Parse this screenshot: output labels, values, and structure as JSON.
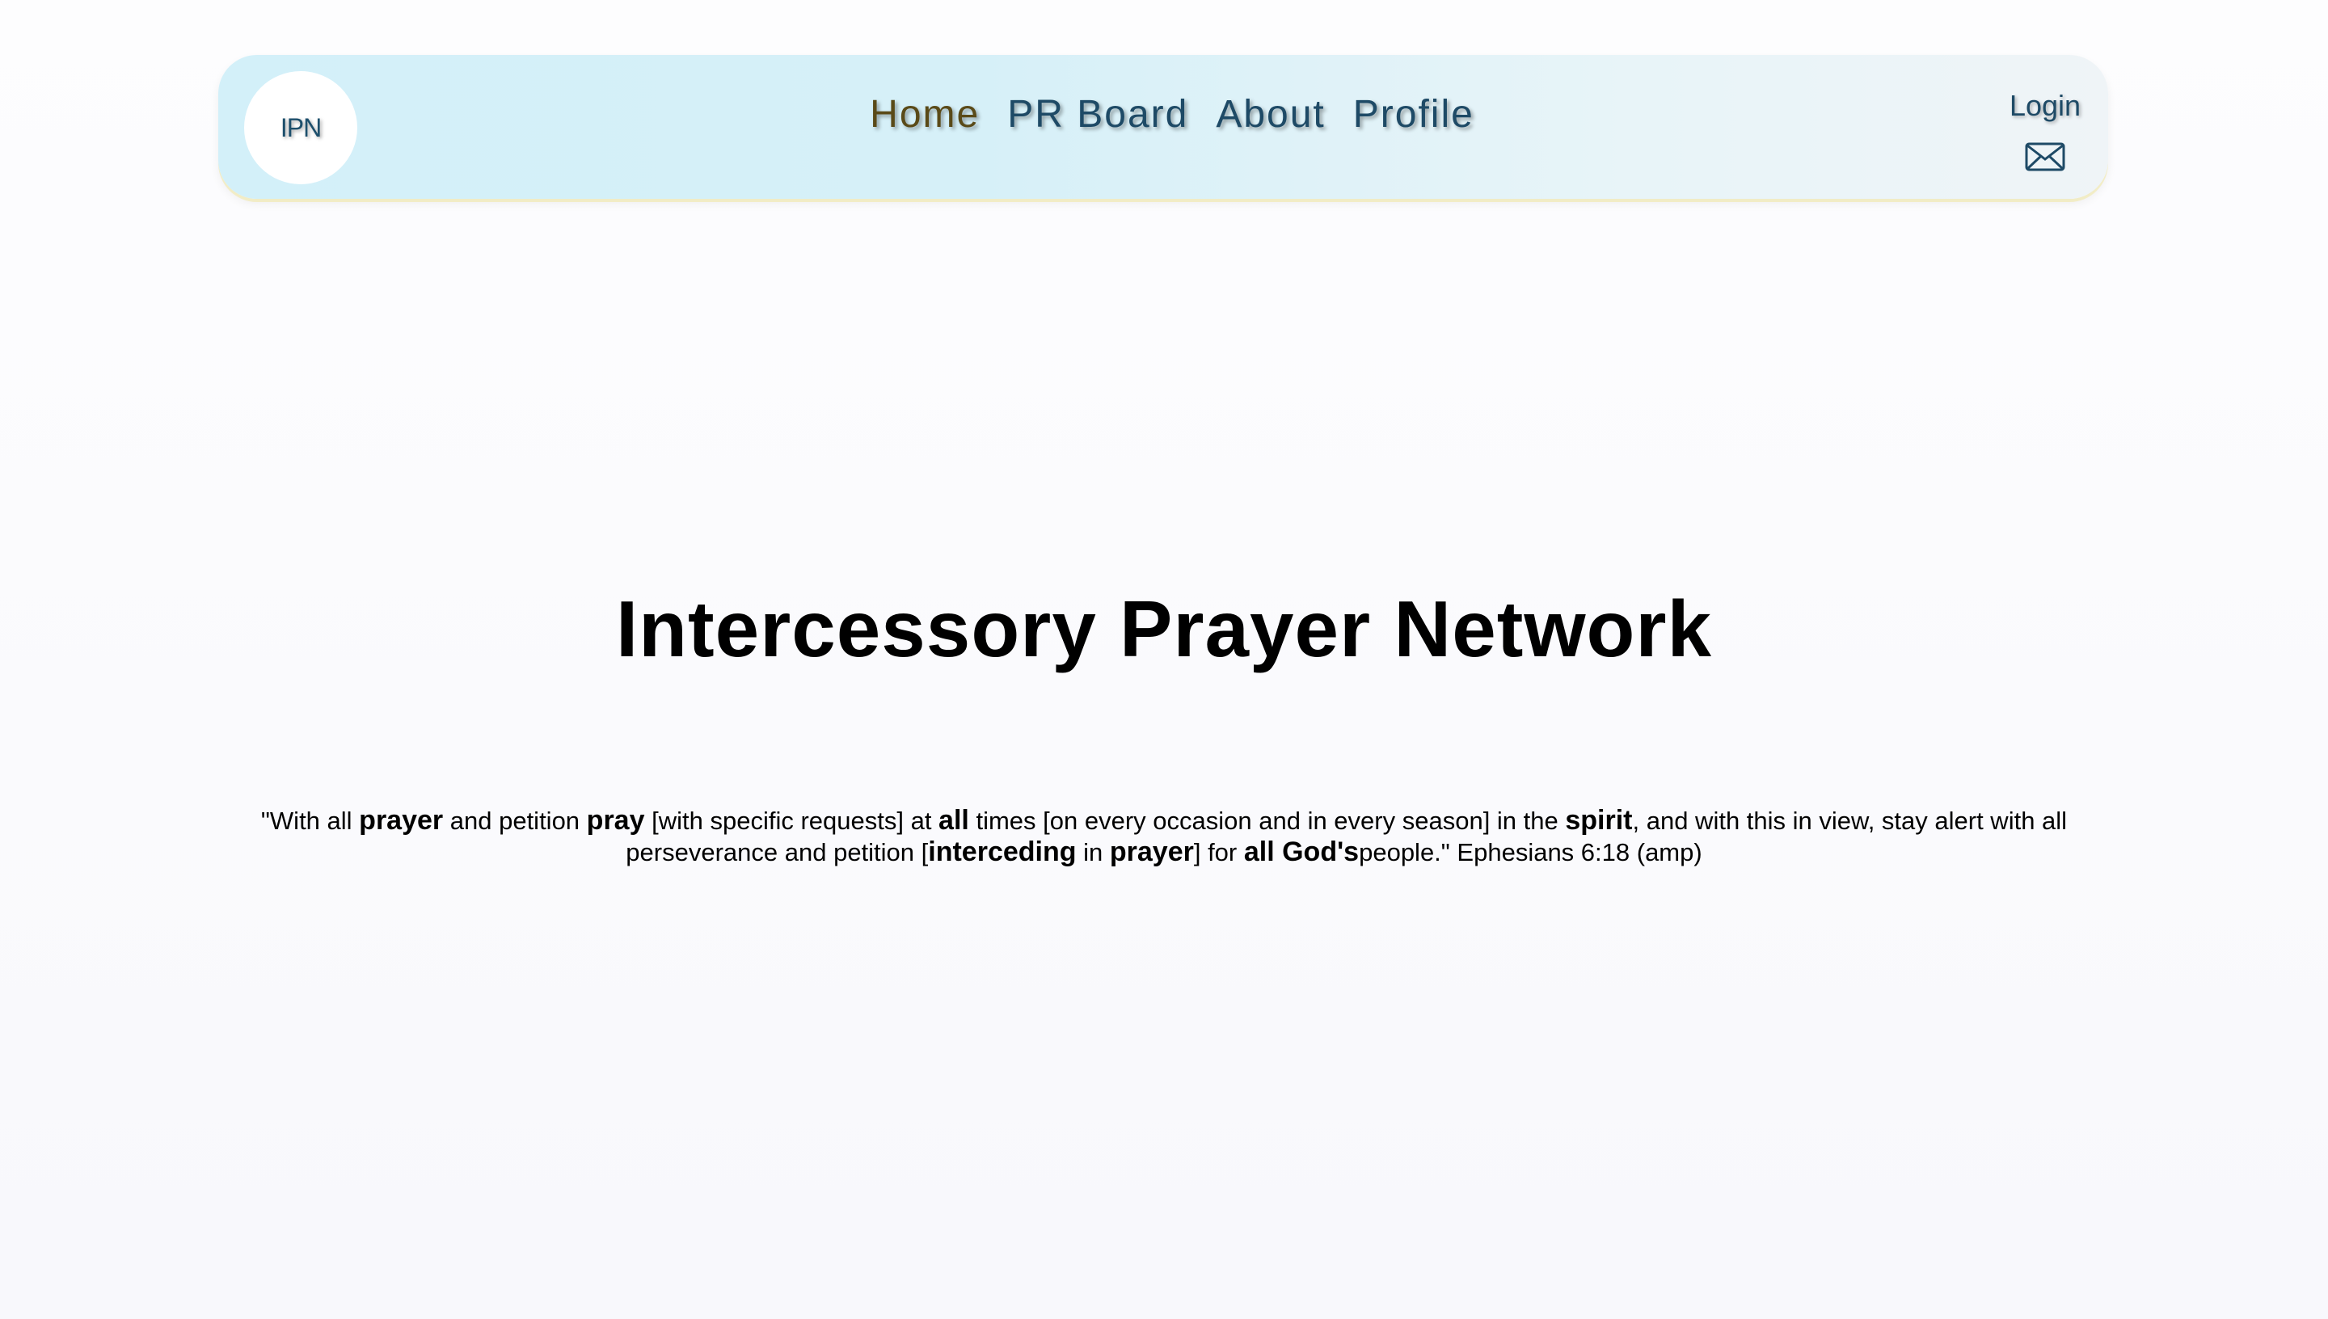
{
  "header": {
    "logo_text": "IPN",
    "nav": [
      {
        "label": "Home",
        "active": true
      },
      {
        "label": "PR Board",
        "active": false
      },
      {
        "label": "About",
        "active": false
      },
      {
        "label": "Profile",
        "active": false
      }
    ],
    "login_label": "Login",
    "mail_icon": "envelope-icon"
  },
  "hero": {
    "title": "Intercessory Prayer Network"
  },
  "verse": {
    "segments": [
      {
        "text": "\"With all ",
        "bold": false
      },
      {
        "text": "prayer",
        "bold": true
      },
      {
        "text": " and petition ",
        "bold": false
      },
      {
        "text": "pray",
        "bold": true
      },
      {
        "text": " [with specific requests] at ",
        "bold": false
      },
      {
        "text": "all",
        "bold": true
      },
      {
        "text": " times [on every occasion and in every season] in the ",
        "bold": false
      },
      {
        "text": "spirit",
        "bold": true
      },
      {
        "text": ", and with this in view, stay alert with all perseverance and petition [",
        "bold": false
      },
      {
        "text": "interceding",
        "bold": true
      },
      {
        "text": " in ",
        "bold": false
      },
      {
        "text": "prayer",
        "bold": true
      },
      {
        "text": "] for ",
        "bold": false
      },
      {
        "text": "all God's",
        "bold": true
      },
      {
        "text": "people.\" Ephesians 6:18 (amp)",
        "bold": false
      }
    ]
  },
  "colors": {
    "nav_text": "#1e4a66",
    "nav_active": "#5a4a18",
    "navbar_bg": "#d6f0f8"
  }
}
